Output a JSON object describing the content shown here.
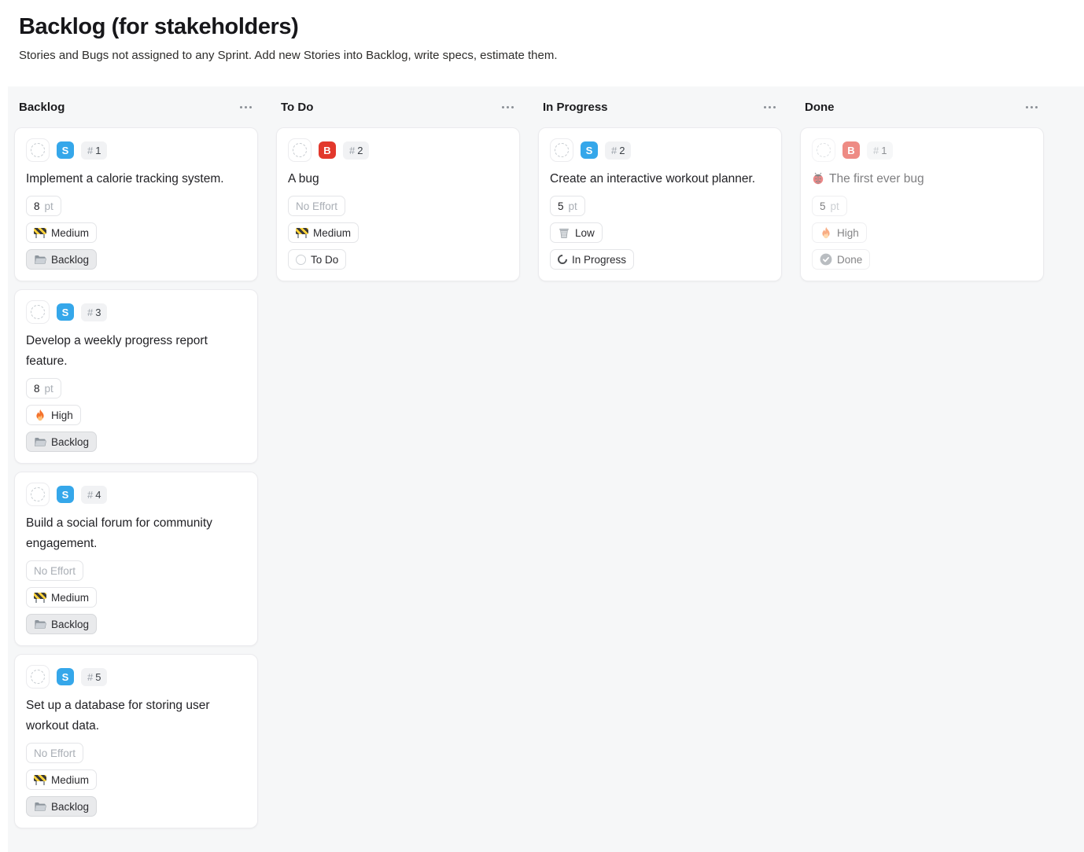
{
  "page": {
    "title": "Backlog (for stakeholders)",
    "subtitle": "Stories and Bugs not assigned to any Sprint. Add new Stories into Backlog, write specs, estimate them."
  },
  "colors": {
    "story_badge": "#35a7ea",
    "bug_badge": "#e2382c",
    "board_background": "#f6f7f8"
  },
  "board": {
    "columns": [
      {
        "title": "Backlog",
        "menu_icon": "ellipsis",
        "cards": [
          {
            "type": "story",
            "type_letter": "S",
            "number_hash": "#",
            "number": "1",
            "title": "Implement a calorie tracking system.",
            "chips": [
              {
                "kind": "effort",
                "value": "8",
                "unit": "pt"
              },
              {
                "kind": "priority",
                "icon": "construction",
                "label": "Medium"
              },
              {
                "kind": "category",
                "icon": "folder",
                "label": "Backlog"
              }
            ]
          },
          {
            "type": "story",
            "type_letter": "S",
            "number_hash": "#",
            "number": "3",
            "title": "Develop a weekly progress report feature.",
            "chips": [
              {
                "kind": "effort",
                "value": "8",
                "unit": "pt"
              },
              {
                "kind": "priority",
                "icon": "fire",
                "label": "High"
              },
              {
                "kind": "category",
                "icon": "folder",
                "label": "Backlog"
              }
            ]
          },
          {
            "type": "story",
            "type_letter": "S",
            "number_hash": "#",
            "number": "4",
            "title": "Build a social forum for community engagement.",
            "chips": [
              {
                "kind": "effort-empty",
                "label": "No Effort"
              },
              {
                "kind": "priority",
                "icon": "construction",
                "label": "Medium"
              },
              {
                "kind": "category",
                "icon": "folder",
                "label": "Backlog"
              }
            ]
          },
          {
            "type": "story",
            "type_letter": "S",
            "number_hash": "#",
            "number": "5",
            "title": "Set up a database for storing user workout data.",
            "chips": [
              {
                "kind": "effort-empty",
                "label": "No Effort"
              },
              {
                "kind": "priority",
                "icon": "construction",
                "label": "Medium"
              },
              {
                "kind": "category",
                "icon": "folder",
                "label": "Backlog"
              }
            ]
          }
        ]
      },
      {
        "title": "To Do",
        "menu_icon": "ellipsis",
        "cards": [
          {
            "type": "bug",
            "type_letter": "B",
            "number_hash": "#",
            "number": "2",
            "title": "A bug",
            "chips": [
              {
                "kind": "effort-empty",
                "label": "No Effort"
              },
              {
                "kind": "priority",
                "icon": "construction",
                "label": "Medium"
              },
              {
                "kind": "status",
                "icon": "todo-circle",
                "label": "To Do"
              }
            ]
          }
        ]
      },
      {
        "title": "In Progress",
        "menu_icon": "ellipsis",
        "cards": [
          {
            "type": "story",
            "type_letter": "S",
            "number_hash": "#",
            "number": "2",
            "title": "Create an interactive workout planner.",
            "chips": [
              {
                "kind": "effort",
                "value": "5",
                "unit": "pt"
              },
              {
                "kind": "priority",
                "icon": "wastebasket",
                "label": "Low"
              },
              {
                "kind": "status",
                "icon": "in-progress-spinner",
                "label": "In Progress"
              }
            ]
          }
        ]
      },
      {
        "title": "Done",
        "menu_icon": "ellipsis",
        "cards": [
          {
            "type": "bug",
            "type_letter": "B",
            "number_hash": "#",
            "number": "1",
            "title": "The first ever bug",
            "title_icon": "ladybug",
            "faded": true,
            "chips": [
              {
                "kind": "effort",
                "value": "5",
                "unit": "pt"
              },
              {
                "kind": "priority",
                "icon": "fire",
                "label": "High"
              },
              {
                "kind": "status",
                "icon": "done-check",
                "label": "Done"
              }
            ]
          }
        ]
      }
    ]
  }
}
